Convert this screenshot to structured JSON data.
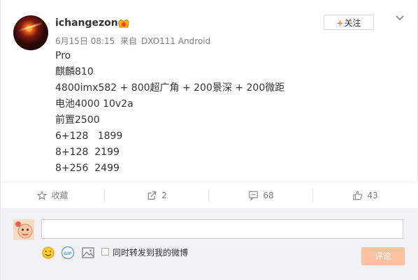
{
  "post": {
    "username": "ichangezone",
    "date": "6月15日 08:15",
    "source_prefix": "来自",
    "source": "DXO111 Android",
    "follow_label": "关注",
    "follow_plus": "+",
    "content_lines": [
      "Pro",
      "麒麟810",
      "4800imx582 + 800超广角 + 200景深 + 200微距",
      "电池4000 10v2a",
      "前置2500",
      "6+128   1899",
      "8+128  2199",
      "8+256  2499"
    ]
  },
  "actions": {
    "favorite_label": "收藏",
    "repost_count": "2",
    "comment_count": "68",
    "like_count": "43"
  },
  "comment_box": {
    "input_value": "",
    "forward_label": "同时转发到我的微博",
    "submit_label": "评论",
    "gif_label": "GIF"
  },
  "colors": {
    "accent": "#ff8200",
    "submit_disabled": "#ffc09f",
    "muted_text": "#808080"
  }
}
